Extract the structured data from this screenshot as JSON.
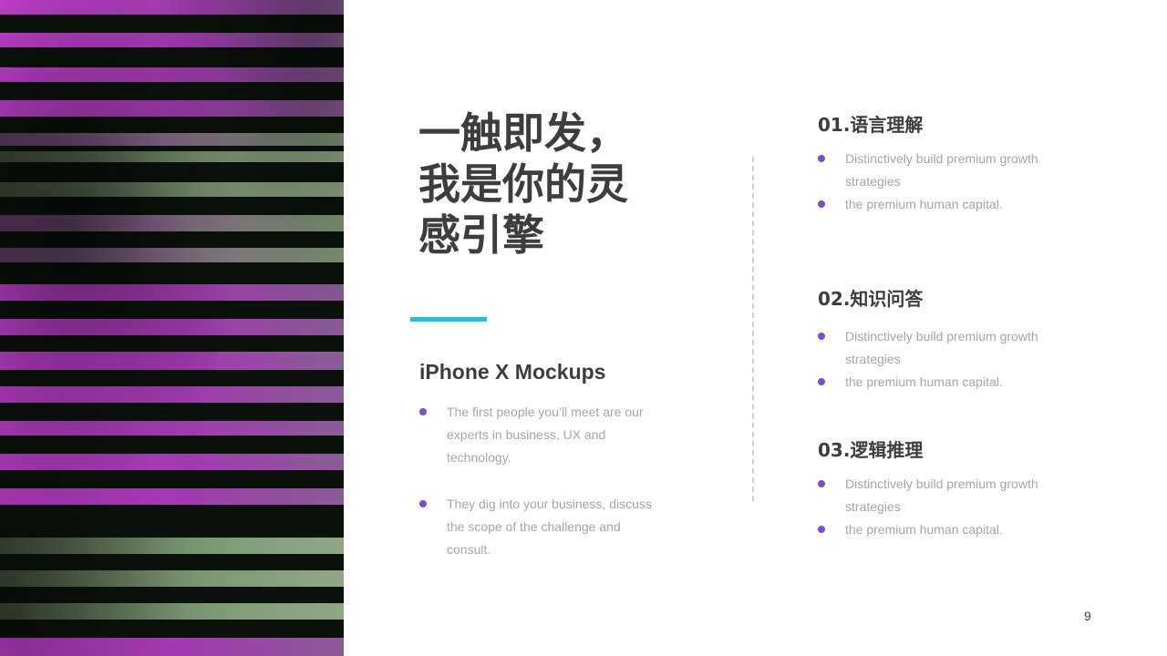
{
  "headline_lines": [
    "一触即发，",
    "我是你的灵",
    "感引擎"
  ],
  "subtitle": "iPhone X Mockups",
  "left_bullets": [
    "The first people you’ll meet are our experts in business, UX  and technology.",
    "They dig into your business, discuss the scope of the challenge and consult."
  ],
  "sections": [
    {
      "title": "01.语言理解",
      "bullets": [
        "Distinctively build premium growth strategies",
        "the premium  human capital."
      ]
    },
    {
      "title": "02.知识问答",
      "bullets": [
        "Distinctively build premium growth strategies",
        "the premium  human capital."
      ]
    },
    {
      "title": "03.逻辑推理",
      "bullets": [
        "Distinctively build premium growth strategies",
        "the premium  human capital."
      ]
    }
  ],
  "page_number": "9",
  "colors": {
    "accent_bar": "#1dc4d8",
    "bullet": "#7a4fc4",
    "heading": "#3d3d3d",
    "body_text": "#a6a6a6",
    "stripe_magenta": "#c23fd0",
    "stripe_green": "#7c9a72",
    "stripe_dark": "#0b120b"
  },
  "icons": [
    "bullet-dot-icon"
  ]
}
